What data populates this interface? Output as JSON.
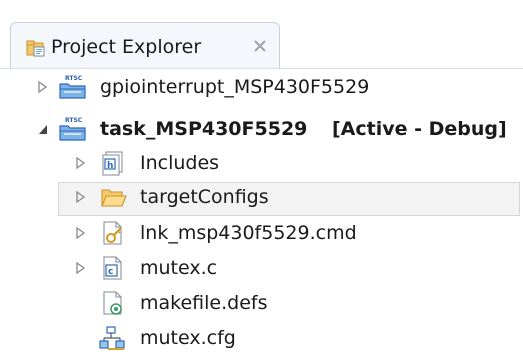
{
  "view": {
    "tab_title": "Project Explorer",
    "tab_icon": "project-explorer-icon",
    "close_icon": "close-tab-icon"
  },
  "tree": {
    "items": [
      {
        "label": "gpiointerrupt_MSP430F5529",
        "icon": "rtsc-project-icon",
        "state": "collapsed",
        "active": false
      },
      {
        "label": "task_MSP430F5529",
        "active_label": "[Active - Debug]",
        "icon": "rtsc-project-icon",
        "state": "expanded",
        "active": true
      },
      {
        "label": "Includes",
        "icon": "includes-icon",
        "state": "collapsed",
        "active": false
      },
      {
        "label": "targetConfigs",
        "icon": "folder-icon",
        "state": "collapsed",
        "active": false
      },
      {
        "label": "lnk_msp430f5529.cmd",
        "icon": "linker-cmd-file-icon",
        "state": "collapsed",
        "active": false
      },
      {
        "label": "mutex.c",
        "icon": "c-file-icon",
        "state": "collapsed",
        "active": false
      },
      {
        "label": "makefile.defs",
        "icon": "makefile-defs-icon",
        "state": "leaf",
        "active": false
      },
      {
        "label": "mutex.cfg",
        "icon": "config-file-icon",
        "state": "leaf",
        "active": false
      }
    ]
  },
  "colors": {
    "tab_background": "#f4f8fc",
    "tab_border": "#c9d2dc",
    "selection_background": "#f3f3f3",
    "selection_border": "#d6d6d6",
    "folder": "#f6c86a",
    "project_blue": "#3f7cc8"
  }
}
